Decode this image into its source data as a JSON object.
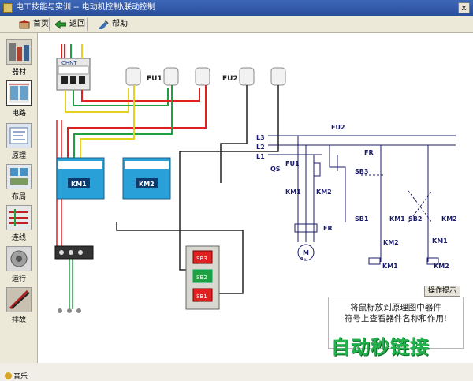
{
  "window": {
    "title": "电工技能与实训 -- 电动机控制\\联动控制",
    "close_label": "x"
  },
  "toolbar": {
    "home_label": "首页",
    "back_label": "返回",
    "help_label": "帮助"
  },
  "sidebar": {
    "items": [
      {
        "label": "器材",
        "icon": "components-icon"
      },
      {
        "label": "电路",
        "icon": "circuit-icon",
        "active": true
      },
      {
        "label": "原理",
        "icon": "principle-icon"
      },
      {
        "label": "布局",
        "icon": "layout-icon"
      },
      {
        "label": "连线",
        "icon": "wiring-icon"
      },
      {
        "label": "运行",
        "icon": "run-icon"
      },
      {
        "label": "排故",
        "icon": "troubleshoot-icon"
      }
    ],
    "music_label": "音乐"
  },
  "wiring": {
    "fu1": "FU1",
    "fu2": "FU2",
    "km1": "KM1",
    "km2": "KM2",
    "sb1": "SB1",
    "sb2": "SB2",
    "sb3": "SB3",
    "breaker_brand": "CHNT"
  },
  "schematic": {
    "l3": "L3",
    "l2": "L2",
    "l1": "L1",
    "qs": "QS",
    "fu1": "FU1",
    "fu2": "FU2",
    "fr": "FR",
    "fr2": "FR",
    "sb3": "SB3",
    "sb1": "SB1",
    "sb2": "SB2",
    "km1a": "KM1",
    "km2a": "KM2",
    "km1b": "KM1",
    "km2b": "KM2",
    "km2c": "KM2",
    "km1c": "KM1",
    "km1d": "KM1",
    "km2d": "KM2",
    "motor": "M",
    "motor_sub": "3~"
  },
  "tip": {
    "button_label": "操作提示",
    "line1": "将鼠标放到原理图中器件",
    "line2": "符号上查看器件名称和作用!"
  },
  "watermark": "自动秒链接",
  "colors": {
    "title_bg": "#2a4f9a",
    "wire_red": "#e02020",
    "wire_green": "#20a040",
    "wire_yellow": "#e6d020",
    "schematic_blue": "#1b1b6e",
    "contactor_blue": "#2aa0d8"
  }
}
